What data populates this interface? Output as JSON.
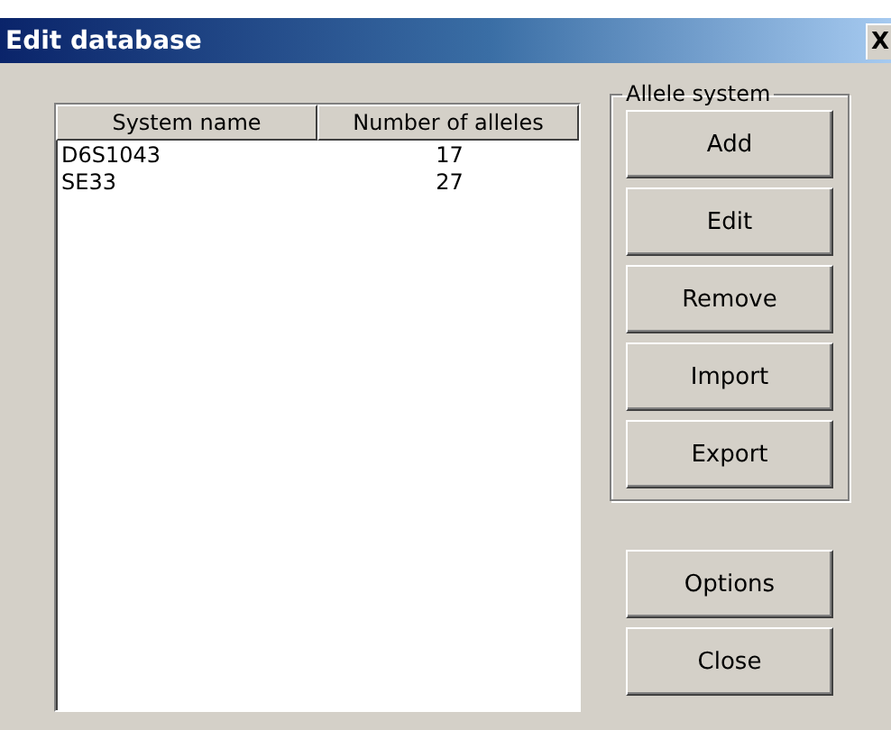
{
  "window": {
    "title": "Edit database",
    "close": "X"
  },
  "list": {
    "columns": [
      "System name",
      "Number of alleles"
    ],
    "rows": [
      {
        "name": "D6S1043",
        "alleles": "17"
      },
      {
        "name": "SE33",
        "alleles": "27"
      }
    ]
  },
  "group": {
    "title": "Allele system",
    "buttons": [
      "Add",
      "Edit",
      "Remove",
      "Import",
      "Export"
    ]
  },
  "buttons": [
    "Options",
    "Close"
  ]
}
